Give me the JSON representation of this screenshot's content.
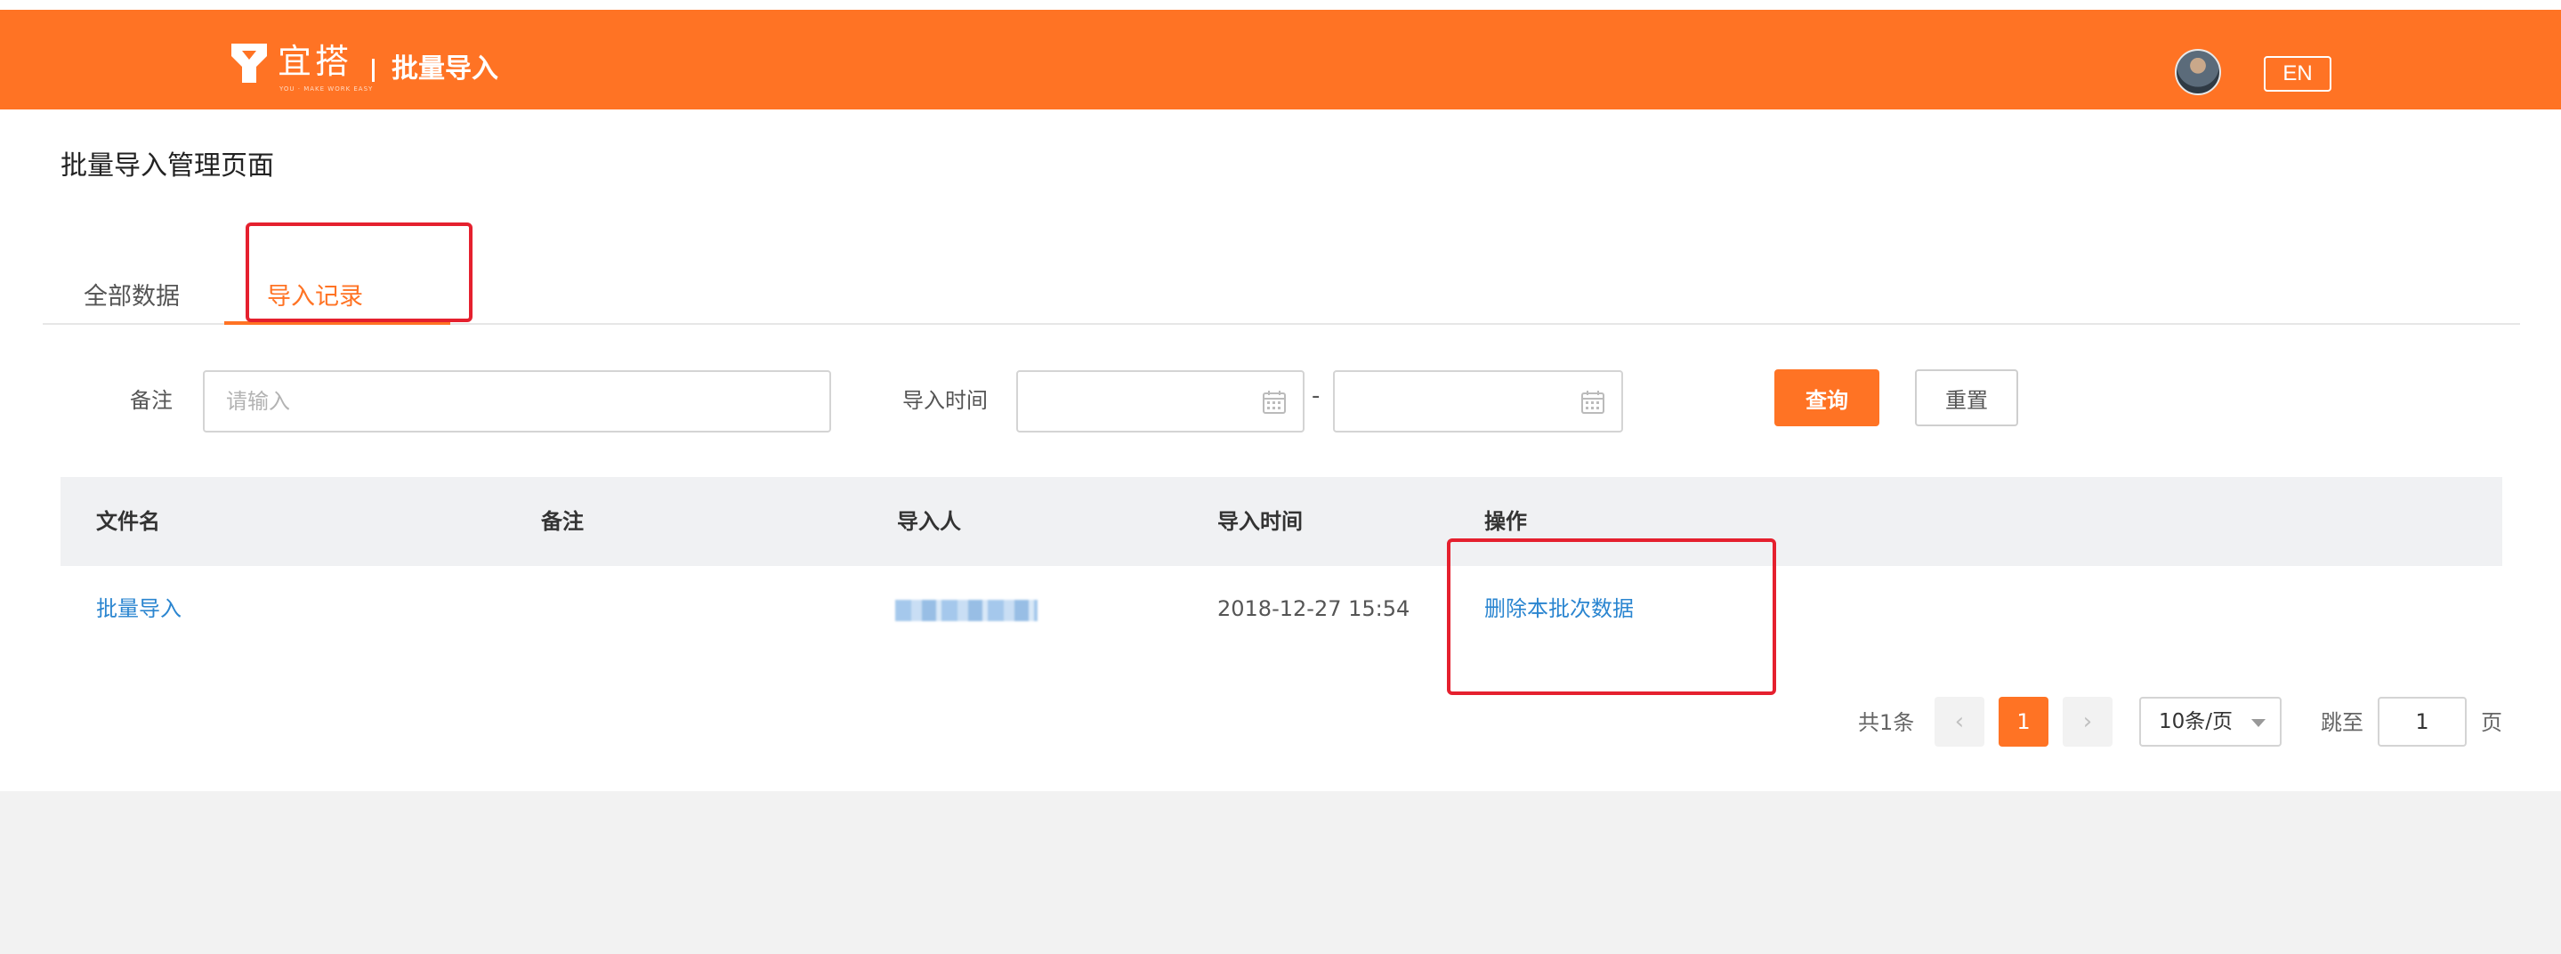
{
  "header": {
    "logo_text": "宜搭",
    "logo_subtext": "YOU · MAKE WORK EASY",
    "title": "批量导入",
    "avatar_icon": "user-avatar",
    "lang_button": "EN",
    "bg_color": "#ff7324"
  },
  "page": {
    "title": "批量导入管理页面"
  },
  "tabs": [
    {
      "label": "全部数据",
      "active": false
    },
    {
      "label": "导入记录",
      "active": true
    }
  ],
  "filters": {
    "remark_label": "备注",
    "remark_placeholder": "请输入",
    "time_label": "导入时间",
    "range_separator": "-",
    "calendar_icon": "calendar-icon",
    "query_button": "查询",
    "reset_button": "重置"
  },
  "table": {
    "columns": [
      "文件名",
      "备注",
      "导入人",
      "导入时间",
      "操作"
    ],
    "rows": [
      {
        "file_name": "批量导入",
        "remark": "",
        "importer": "",
        "import_time": "2018-12-27 15:54",
        "action": "删除本批次数据"
      }
    ]
  },
  "pagination": {
    "total": "共1条",
    "prev_icon": "chevron-left-icon",
    "current_page": "1",
    "next_icon": "chevron-right-icon",
    "page_size": "10条/页",
    "jump_label": "跳至",
    "jump_value": "1",
    "page_suffix": "页"
  },
  "colors": {
    "accent": "#ff7324",
    "link": "#2a85d0",
    "annotation": "#e5202e"
  }
}
